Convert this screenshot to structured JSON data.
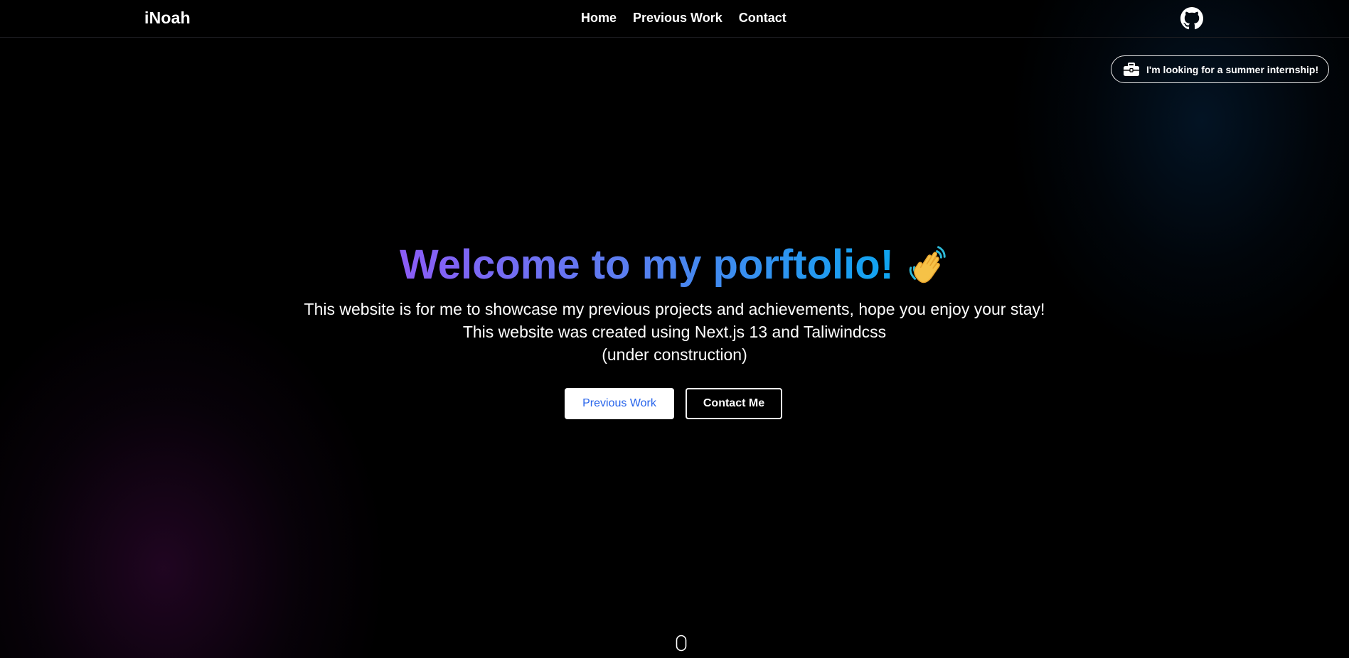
{
  "navbar": {
    "brand": "iNoah",
    "links": [
      "Home",
      "Previous Work",
      "Contact"
    ],
    "github_icon": "github-icon"
  },
  "badge": {
    "icon": "briefcase-icon",
    "text": "I'm looking for a summer internship!"
  },
  "hero": {
    "title": "Welcome to my porftolio!",
    "emoji": "waving-hand-icon",
    "line1": "This website is for me to showcase my previous projects and achievements, hope you enjoy your stay!",
    "line2": "This website was created using Next.js 13 and Taliwindcss",
    "line3": "(under construction)",
    "primary_button": "Previous Work",
    "secondary_button": "Contact Me"
  },
  "scroll_indicator": "mouse-scroll-icon",
  "colors": {
    "background": "#000000",
    "gradient_start": "#8b5cf6",
    "gradient_end": "#0ea5f0",
    "primary_button_text": "#2563eb"
  }
}
